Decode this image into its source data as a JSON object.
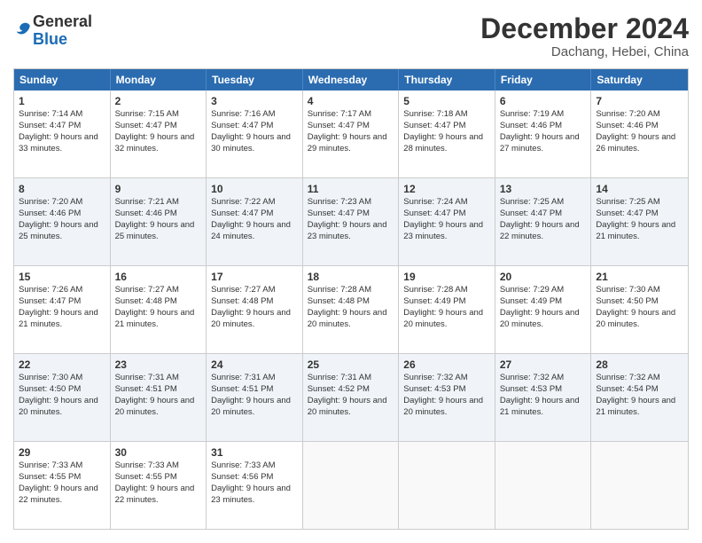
{
  "logo": {
    "general": "General",
    "blue": "Blue"
  },
  "header": {
    "month": "December 2024",
    "location": "Dachang, Hebei, China"
  },
  "days": [
    "Sunday",
    "Monday",
    "Tuesday",
    "Wednesday",
    "Thursday",
    "Friday",
    "Saturday"
  ],
  "weeks": [
    [
      {
        "day": "1",
        "sunrise": "7:14 AM",
        "sunset": "4:47 PM",
        "daylight": "9 hours and 33 minutes."
      },
      {
        "day": "2",
        "sunrise": "7:15 AM",
        "sunset": "4:47 PM",
        "daylight": "9 hours and 32 minutes."
      },
      {
        "day": "3",
        "sunrise": "7:16 AM",
        "sunset": "4:47 PM",
        "daylight": "9 hours and 30 minutes."
      },
      {
        "day": "4",
        "sunrise": "7:17 AM",
        "sunset": "4:47 PM",
        "daylight": "9 hours and 29 minutes."
      },
      {
        "day": "5",
        "sunrise": "7:18 AM",
        "sunset": "4:47 PM",
        "daylight": "9 hours and 28 minutes."
      },
      {
        "day": "6",
        "sunrise": "7:19 AM",
        "sunset": "4:46 PM",
        "daylight": "9 hours and 27 minutes."
      },
      {
        "day": "7",
        "sunrise": "7:20 AM",
        "sunset": "4:46 PM",
        "daylight": "9 hours and 26 minutes."
      }
    ],
    [
      {
        "day": "8",
        "sunrise": "7:20 AM",
        "sunset": "4:46 PM",
        "daylight": "9 hours and 25 minutes."
      },
      {
        "day": "9",
        "sunrise": "7:21 AM",
        "sunset": "4:46 PM",
        "daylight": "9 hours and 25 minutes."
      },
      {
        "day": "10",
        "sunrise": "7:22 AM",
        "sunset": "4:47 PM",
        "daylight": "9 hours and 24 minutes."
      },
      {
        "day": "11",
        "sunrise": "7:23 AM",
        "sunset": "4:47 PM",
        "daylight": "9 hours and 23 minutes."
      },
      {
        "day": "12",
        "sunrise": "7:24 AM",
        "sunset": "4:47 PM",
        "daylight": "9 hours and 23 minutes."
      },
      {
        "day": "13",
        "sunrise": "7:25 AM",
        "sunset": "4:47 PM",
        "daylight": "9 hours and 22 minutes."
      },
      {
        "day": "14",
        "sunrise": "7:25 AM",
        "sunset": "4:47 PM",
        "daylight": "9 hours and 21 minutes."
      }
    ],
    [
      {
        "day": "15",
        "sunrise": "7:26 AM",
        "sunset": "4:47 PM",
        "daylight": "9 hours and 21 minutes."
      },
      {
        "day": "16",
        "sunrise": "7:27 AM",
        "sunset": "4:48 PM",
        "daylight": "9 hours and 21 minutes."
      },
      {
        "day": "17",
        "sunrise": "7:27 AM",
        "sunset": "4:48 PM",
        "daylight": "9 hours and 20 minutes."
      },
      {
        "day": "18",
        "sunrise": "7:28 AM",
        "sunset": "4:48 PM",
        "daylight": "9 hours and 20 minutes."
      },
      {
        "day": "19",
        "sunrise": "7:28 AM",
        "sunset": "4:49 PM",
        "daylight": "9 hours and 20 minutes."
      },
      {
        "day": "20",
        "sunrise": "7:29 AM",
        "sunset": "4:49 PM",
        "daylight": "9 hours and 20 minutes."
      },
      {
        "day": "21",
        "sunrise": "7:30 AM",
        "sunset": "4:50 PM",
        "daylight": "9 hours and 20 minutes."
      }
    ],
    [
      {
        "day": "22",
        "sunrise": "7:30 AM",
        "sunset": "4:50 PM",
        "daylight": "9 hours and 20 minutes."
      },
      {
        "day": "23",
        "sunrise": "7:31 AM",
        "sunset": "4:51 PM",
        "daylight": "9 hours and 20 minutes."
      },
      {
        "day": "24",
        "sunrise": "7:31 AM",
        "sunset": "4:51 PM",
        "daylight": "9 hours and 20 minutes."
      },
      {
        "day": "25",
        "sunrise": "7:31 AM",
        "sunset": "4:52 PM",
        "daylight": "9 hours and 20 minutes."
      },
      {
        "day": "26",
        "sunrise": "7:32 AM",
        "sunset": "4:53 PM",
        "daylight": "9 hours and 20 minutes."
      },
      {
        "day": "27",
        "sunrise": "7:32 AM",
        "sunset": "4:53 PM",
        "daylight": "9 hours and 21 minutes."
      },
      {
        "day": "28",
        "sunrise": "7:32 AM",
        "sunset": "4:54 PM",
        "daylight": "9 hours and 21 minutes."
      }
    ],
    [
      {
        "day": "29",
        "sunrise": "7:33 AM",
        "sunset": "4:55 PM",
        "daylight": "9 hours and 22 minutes."
      },
      {
        "day": "30",
        "sunrise": "7:33 AM",
        "sunset": "4:55 PM",
        "daylight": "9 hours and 22 minutes."
      },
      {
        "day": "31",
        "sunrise": "7:33 AM",
        "sunset": "4:56 PM",
        "daylight": "9 hours and 23 minutes."
      },
      null,
      null,
      null,
      null
    ]
  ],
  "labels": {
    "sunrise": "Sunrise:",
    "sunset": "Sunset:",
    "daylight": "Daylight:"
  }
}
